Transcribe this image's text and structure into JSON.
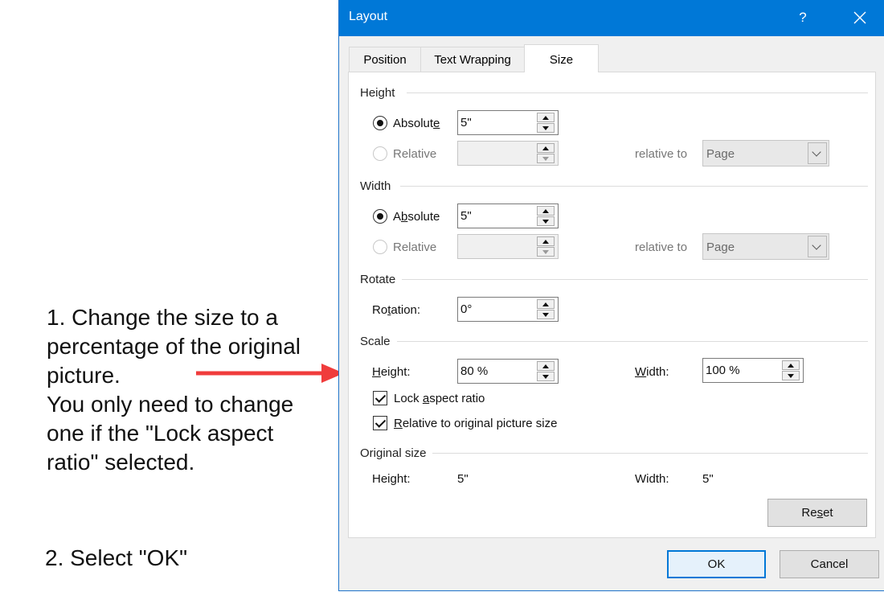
{
  "annotation": {
    "step1_lines": [
      "1. Change the size to a",
      "percentage of the original",
      "picture.",
      "You only need to change",
      "one if the \"Lock aspect",
      "ratio\" selected."
    ],
    "step2": "2. Select \"OK\"",
    "arrow_color": "#f03c3c"
  },
  "dialog": {
    "title": "Layout",
    "help_label": "?",
    "title_bar_color": "#0078d7",
    "tabs": [
      {
        "label": "Position",
        "active": false
      },
      {
        "label": "Text Wrapping",
        "active": false
      },
      {
        "label": "Size",
        "active": true
      }
    ],
    "height": {
      "section": "Height",
      "absolute_label_pre": "Absolut",
      "absolute_label_key": "e",
      "absolute_value": "5\"",
      "relative_label": "Relative",
      "relative_to_label": "relative to",
      "relative_to_value": "Page"
    },
    "width": {
      "section": "Width",
      "absolute_label_pre": "A",
      "absolute_label_key": "b",
      "absolute_label_post": "solute",
      "absolute_value": "5\"",
      "relative_label": "Relative",
      "relative_to_label": "relative to",
      "relative_to_value": "Page"
    },
    "rotate": {
      "section": "Rotate",
      "label_pre": "Ro",
      "label_key": "t",
      "label_post": "ation:",
      "value": "0°"
    },
    "scale": {
      "section": "Scale",
      "height_label_key": "H",
      "height_label_post": "eight:",
      "height_value": "80 %",
      "width_label_key": "W",
      "width_label_post": "idth:",
      "width_value": "100 %",
      "lock_pre": "Lock ",
      "lock_key": "a",
      "lock_post": "spect ratio",
      "relative_key": "R",
      "relative_post": "elative to original picture size"
    },
    "original": {
      "section": "Original size",
      "height_label": "Height:",
      "height_value": "5\"",
      "width_label": "Width:",
      "width_value": "5\""
    },
    "buttons": {
      "reset_pre": "Re",
      "reset_key": "s",
      "reset_post": "et",
      "ok": "OK",
      "cancel": "Cancel"
    }
  }
}
